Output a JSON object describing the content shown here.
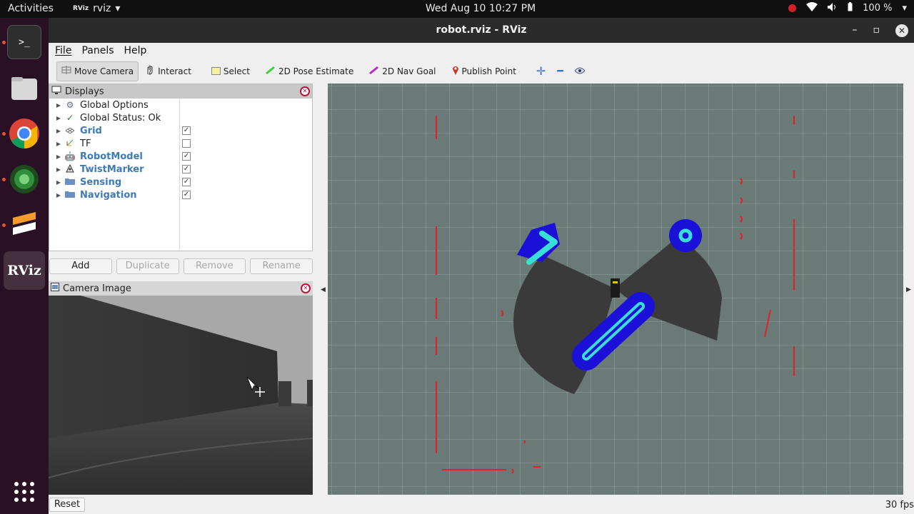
{
  "topbar": {
    "activities": "Activities",
    "app_name": "rviz",
    "app_icon_text": "RViz",
    "clock": "Wed Aug 10  10:27 PM",
    "battery": "100 %"
  },
  "dock": {
    "rviz_label": "RViz"
  },
  "window": {
    "title": "robot.rviz - RViz"
  },
  "menu": {
    "file": "File",
    "panels": "Panels",
    "help": "Help"
  },
  "toolbar": {
    "move_camera": "Move Camera",
    "interact": "Interact",
    "select": "Select",
    "pose_estimate": "2D Pose Estimate",
    "nav_goal": "2D Nav Goal",
    "publish_point": "Publish Point"
  },
  "displays": {
    "title": "Displays",
    "items": [
      {
        "label": "Global Options",
        "icon": "gear-icon",
        "checked": null
      },
      {
        "label": "Global Status: Ok",
        "icon": "check-icon",
        "checked": null
      },
      {
        "label": "Grid",
        "icon": "grid-icon",
        "checked": true
      },
      {
        "label": "TF",
        "icon": "axes-icon",
        "checked": false
      },
      {
        "label": "RobotModel",
        "icon": "robot-icon",
        "checked": true
      },
      {
        "label": "TwistMarker",
        "icon": "marker-icon",
        "checked": true
      },
      {
        "label": "Sensing",
        "icon": "folder-icon",
        "checked": true
      },
      {
        "label": "Navigation",
        "icon": "folder-icon",
        "checked": true
      }
    ],
    "buttons": {
      "add": "Add",
      "duplicate": "Duplicate",
      "remove": "Remove",
      "rename": "Rename"
    }
  },
  "camera": {
    "title": "Camera Image"
  },
  "status": {
    "reset": "Reset",
    "fps": "30 fps"
  },
  "colors": {
    "view_background": "#6a7a76",
    "costmap_blue": "#1a10d8",
    "inflation_cyan": "#37e0d6",
    "laser_red": "#e0202a"
  }
}
